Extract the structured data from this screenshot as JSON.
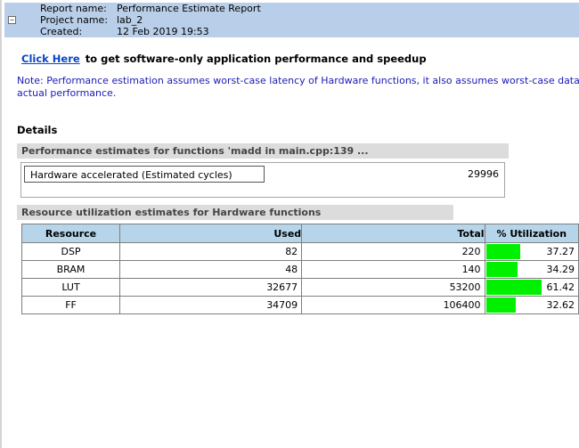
{
  "header": {
    "collapse_symbol": "−",
    "rows": [
      {
        "key": "Report name:",
        "value": "Performance Estimate Report"
      },
      {
        "key": "Project name:",
        "value": "lab_2"
      },
      {
        "key": "Created:",
        "value": "12 Feb 2019 19:53"
      }
    ]
  },
  "link": {
    "text": "Click Here",
    "rest": "to get software-only application performance and speedup"
  },
  "note": {
    "line1": "Note: Performance estimation assumes worst-case latency of Hardware functions, it also assumes worst-case data transf",
    "line2": "actual performance."
  },
  "details_heading": "Details",
  "performance": {
    "title": "Performance estimates for functions 'madd in main.cpp:139 ...",
    "label": "Hardware accelerated (Estimated cycles)",
    "value": "29996"
  },
  "resources": {
    "title": "Resource utilization estimates for Hardware functions",
    "columns": [
      "Resource",
      "Used",
      "Total",
      "% Utilization"
    ],
    "rows": [
      {
        "resource": "DSP",
        "used": "82",
        "total": "220",
        "util": "37.27",
        "util_fraction": 0.3727
      },
      {
        "resource": "BRAM",
        "used": "48",
        "total": "140",
        "util": "34.29",
        "util_fraction": 0.3429
      },
      {
        "resource": "LUT",
        "used": "32677",
        "total": "53200",
        "util": "61.42",
        "util_fraction": 0.6142
      },
      {
        "resource": "FF",
        "used": "34709",
        "total": "106400",
        "util": "32.62",
        "util_fraction": 0.3262
      }
    ],
    "bar_color": "#00f000"
  }
}
